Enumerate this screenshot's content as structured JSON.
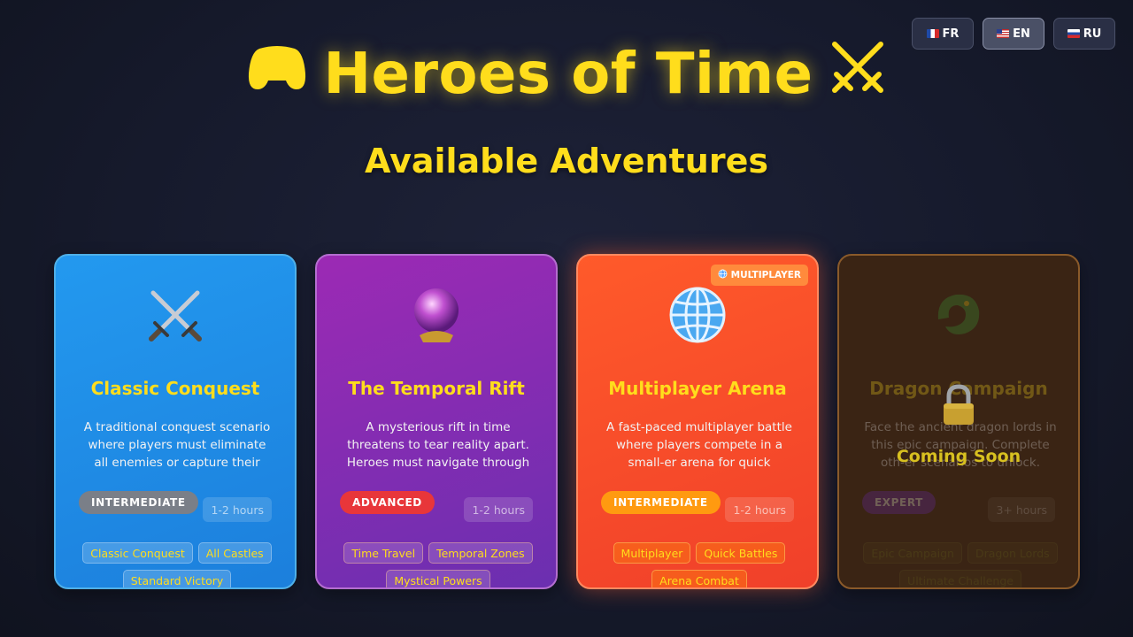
{
  "languages": [
    {
      "code": "FR",
      "active": false
    },
    {
      "code": "EN",
      "active": true
    },
    {
      "code": "RU",
      "active": false
    }
  ],
  "header": {
    "title": "Heroes of Time",
    "title_icons": [
      "gamepad-icon",
      "crossed-swords-icon"
    ]
  },
  "subtitle": "Available Adventures",
  "cards": [
    {
      "icon": "crossed-swords-icon",
      "title": "Classic Conquest",
      "description": "A traditional conquest scenario where players must eliminate all enemies or capture their main...",
      "difficulty": "INTERMEDIATE",
      "difficulty_color": "#7a7f88",
      "duration": "1-2 hours",
      "tags": [
        "Classic Conquest",
        "All Castles",
        "Standard Victory"
      ],
      "badge": null,
      "locked": false
    },
    {
      "icon": "crystal-ball-icon",
      "title": "The Temporal Rift",
      "description": "A mysterious rift in time threatens to tear reality apart. Heroes must navigate through temporal zone...",
      "difficulty": "ADVANCED",
      "difficulty_color": "#e8363a",
      "duration": "1-2 hours",
      "tags": [
        "Time Travel",
        "Temporal Zones",
        "Mystical Powers"
      ],
      "badge": null,
      "locked": false
    },
    {
      "icon": "globe-icon",
      "title": "Multiplayer Arena",
      "description": "A fast-paced multiplayer battle where players compete in a small-er arena for quick matches.",
      "difficulty": "INTERMEDIATE",
      "difficulty_color": "#ff9a10",
      "duration": "1-2 hours",
      "tags": [
        "Multiplayer",
        "Quick Battles",
        "Arena Combat"
      ],
      "badge": "MULTIPLAYER",
      "locked": false
    },
    {
      "icon": "dragon-icon",
      "title": "Dragon Campaign",
      "description": "Face the ancient dragon lords in this epic campaign. Complete oth-er scenarios to unlock.",
      "difficulty": "EXPERT",
      "difficulty_color": "#6a2ab0",
      "duration": "3+ hours",
      "tags": [
        "Epic Campaign",
        "Dragon Lords",
        "Ultimate Challenge"
      ],
      "badge": null,
      "locked": true,
      "locked_label": "Coming Soon"
    }
  ],
  "colors": {
    "accent": "#ffdd1c",
    "background": "#161a2c"
  }
}
